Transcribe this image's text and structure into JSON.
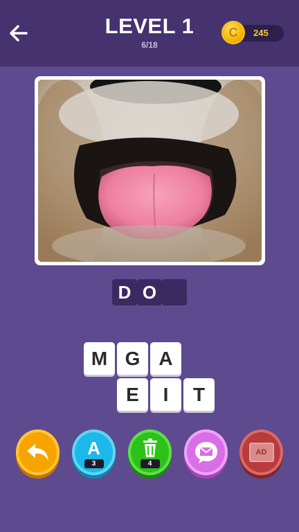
{
  "header": {
    "title": "LEVEL 1",
    "progress": "6/18",
    "coins": "245",
    "coin_symbol": "C"
  },
  "answer": {
    "slots": [
      "D",
      "O",
      ""
    ]
  },
  "letters": [
    "M",
    "G",
    "A",
    "E",
    "I",
    "T"
  ],
  "tools": {
    "hint_letter_icon": "A",
    "hint_letter_count": "3",
    "remove_letters_count": "4",
    "ad_label": "AD"
  },
  "colors": {
    "background": "#5e4a8e",
    "header": "#45326f",
    "undo": "#f7a400",
    "hint": "#1cb8ea",
    "remove": "#2cc21a",
    "share": "#d86ee8",
    "ad": "#b83c3c"
  }
}
